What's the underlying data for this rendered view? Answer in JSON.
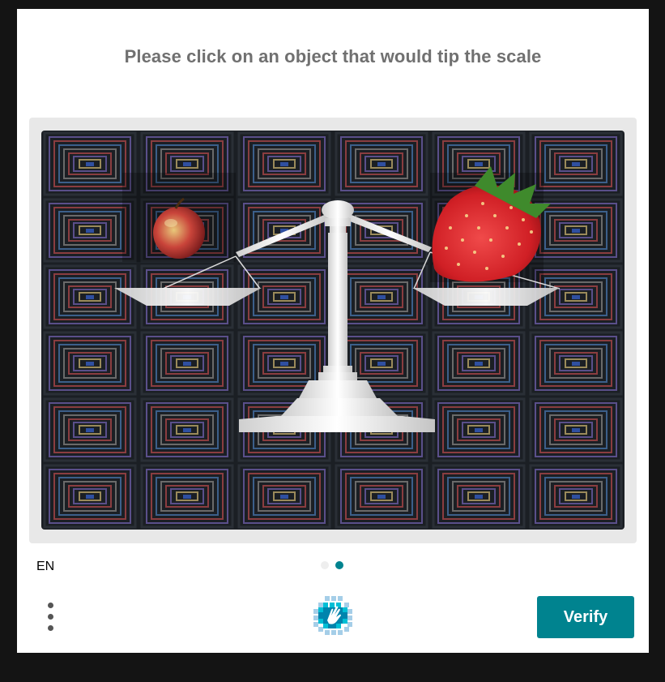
{
  "challenge": {
    "prompt": "Please click on an object that would tip the scale",
    "image_contents": [
      "apple",
      "strawberry",
      "balance-scale"
    ]
  },
  "footer": {
    "language": "EN",
    "pagination": {
      "total": 2,
      "current": 2
    },
    "verify_label": "Verify",
    "menu_icon": "more-vertical-icon",
    "logo_icon": "hcaptcha-logo-icon"
  },
  "colors": {
    "accent": "#00838f",
    "prompt_text": "#707070",
    "overlay": "#141414"
  }
}
